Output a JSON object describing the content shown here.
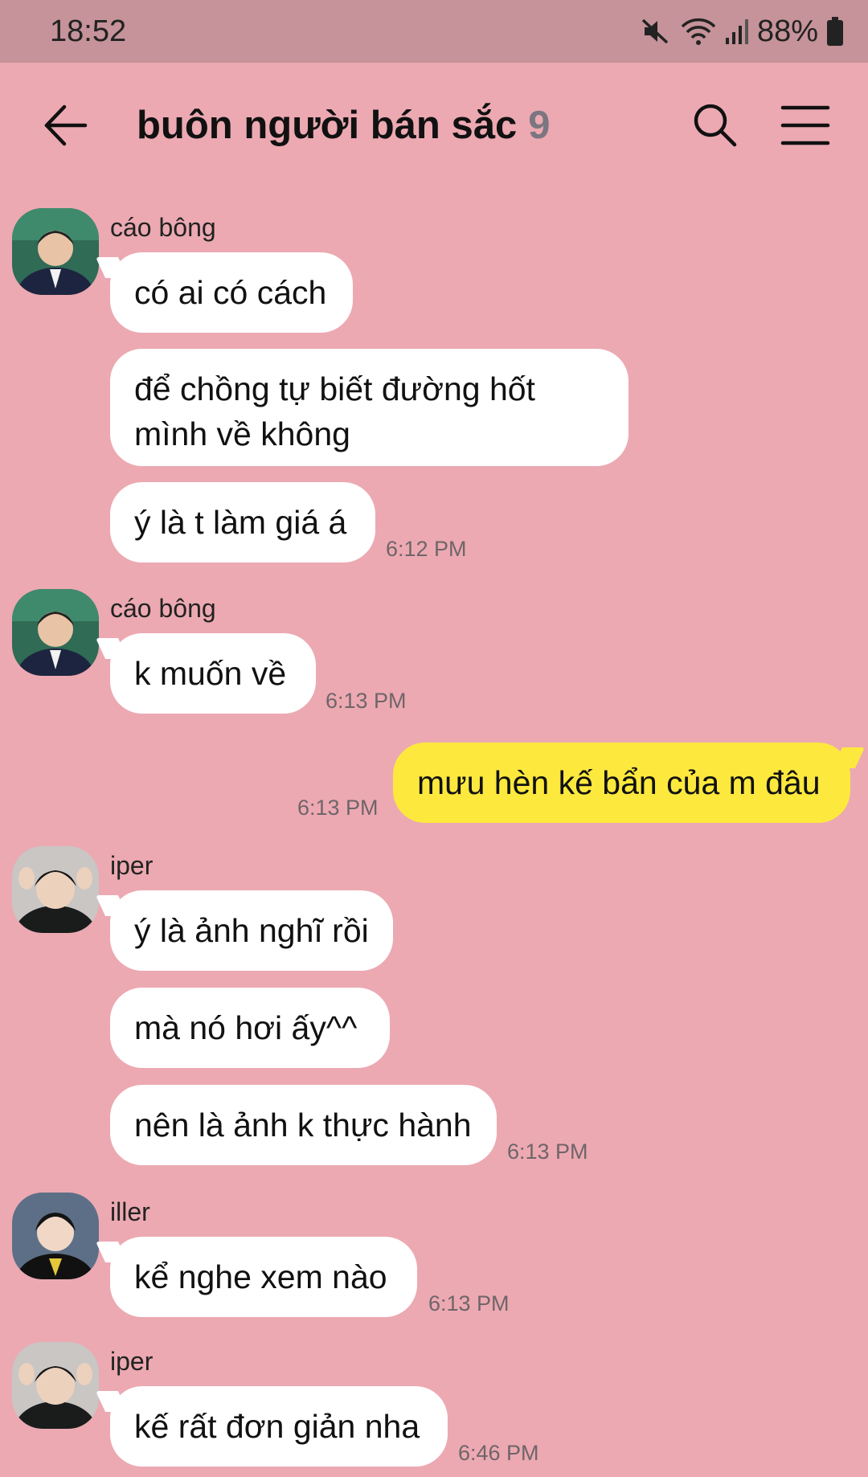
{
  "status_bar": {
    "time": "18:52",
    "battery": "88%",
    "icons": [
      "mute-icon",
      "wifi-icon",
      "signal-icon",
      "battery-icon"
    ]
  },
  "header": {
    "title": "buôn người bán sắc",
    "member_count": "9",
    "icons": [
      "back-arrow-icon",
      "search-icon",
      "menu-icon"
    ]
  },
  "colors": {
    "background": "#eca9b2",
    "status_bar": "#c59399",
    "incoming_bubble": "#ffffff",
    "outgoing_bubble": "#fde93d"
  },
  "messages": [
    {
      "sender": "cáo bông",
      "text": "có ai có cách"
    },
    {
      "text": "để chồng tự biết đường hốt mình về không"
    },
    {
      "text": "ý là t làm giá á",
      "time": "6:12 PM"
    },
    {
      "sender": "cáo bông",
      "text": "k muốn về",
      "time": "6:13 PM"
    },
    {
      "mine": true,
      "text": "mưu hèn kế bẩn của m đâu",
      "time": "6:13 PM"
    },
    {
      "sender": "iper",
      "text": "ý là ảnh nghĩ rồi"
    },
    {
      "text": "mà nó hơi ấy^^"
    },
    {
      "text": "nên là ảnh k thực hành",
      "time": "6:13 PM"
    },
    {
      "sender": "iller",
      "text": "kể nghe xem nào",
      "time": "6:13 PM"
    },
    {
      "sender": "iper",
      "text": "kế rất đơn giản nha",
      "time": "6:46 PM"
    }
  ]
}
